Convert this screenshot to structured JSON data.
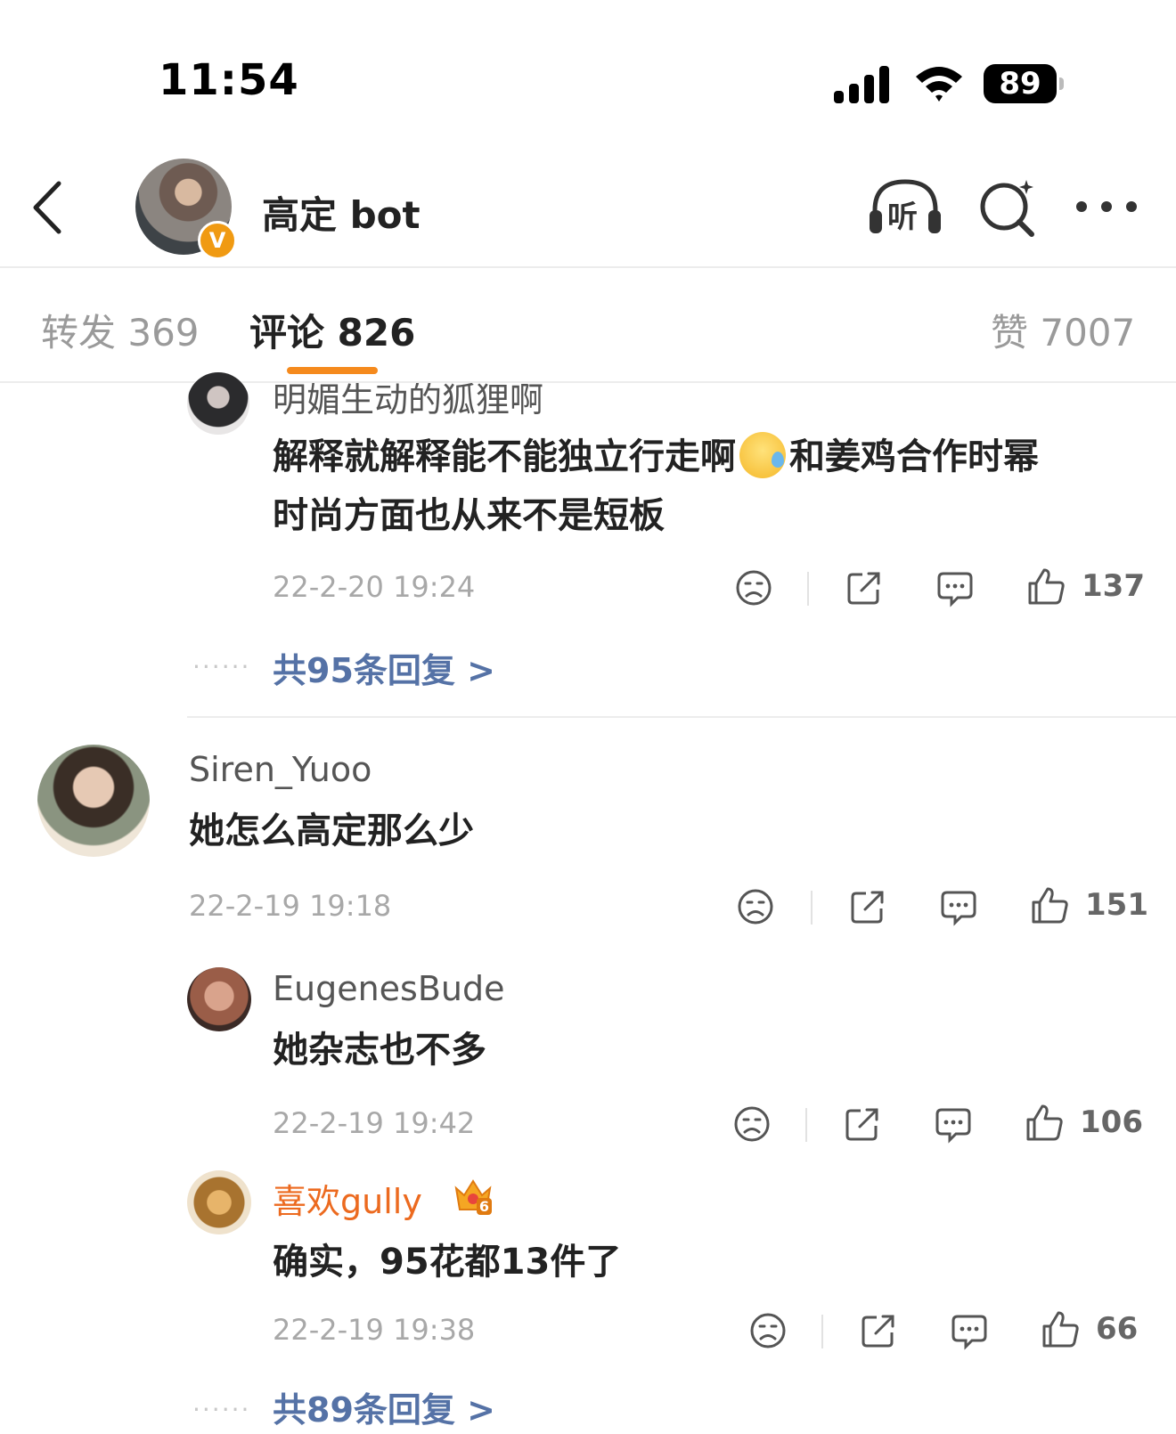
{
  "status_bar": {
    "time": "11:54",
    "battery": "89"
  },
  "header": {
    "title": "高定 bot",
    "verified_badge": "V",
    "listen_label": "听"
  },
  "tabs": {
    "repost": "转发 369",
    "comments": "评论 826",
    "likes": "赞 7007"
  },
  "colors": {
    "accent": "#f58a1d",
    "link": "#5572a6",
    "vip_name": "#ec6a1f"
  },
  "comments": [
    {
      "username": "明媚生动的狐狸啊",
      "text_line1": "解释就解释能不能独立行走啊",
      "emoji": "sweat-face-icon",
      "text_line1b": "和姜鸡合作时幂",
      "text_line2": "时尚方面也从来不是短板",
      "timestamp": "22-2-20 19:24",
      "likes": "137",
      "replies_link": "共95条回复 >",
      "dots": "......"
    },
    {
      "username": "Siren_Yuoo",
      "text": "她怎么高定那么少",
      "timestamp": "22-2-19 19:18",
      "likes": "151",
      "replies": [
        {
          "username": "EugenesBude",
          "text": "她杂志也不多",
          "timestamp": "22-2-19 19:42",
          "likes": "106"
        },
        {
          "username": "喜欢gully",
          "crown_level": "6",
          "text": "确实，95花都13件了",
          "timestamp": "22-2-19 19:38",
          "likes": "66"
        }
      ],
      "replies_link": "共89条回复 >",
      "dots": "......"
    }
  ]
}
